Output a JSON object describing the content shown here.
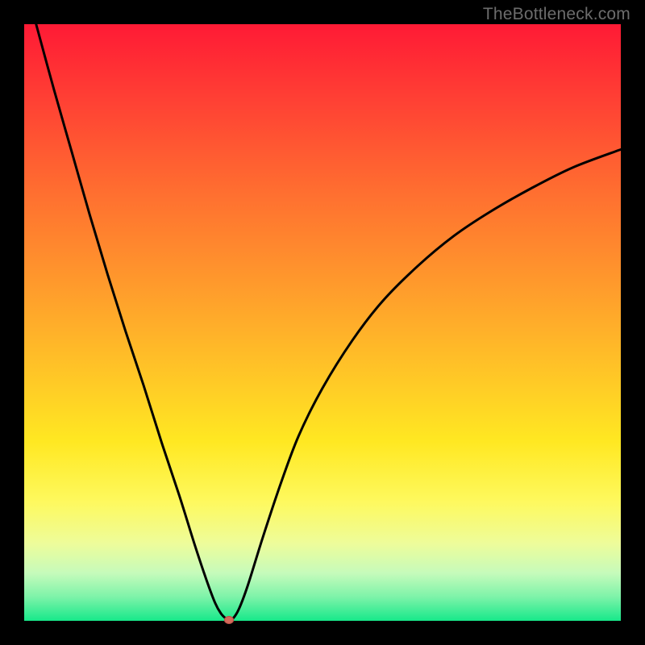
{
  "watermark": "TheBottleneck.com",
  "colors": {
    "frame": "#000000",
    "curve_stroke": "#000000",
    "marker_fill": "#d46a5b",
    "marker_stroke": "#b94f45"
  },
  "chart_data": {
    "type": "line",
    "title": "",
    "xlabel": "",
    "ylabel": "",
    "xlim": [
      0,
      100
    ],
    "ylim": [
      0,
      100
    ],
    "x": [
      2,
      5,
      8,
      11,
      14,
      17,
      20,
      23,
      26,
      28.5,
      30.5,
      32,
      33,
      33.8,
      34.3,
      35,
      36,
      37.5,
      40,
      43,
      46,
      50,
      55,
      60,
      66,
      72,
      78,
      85,
      92,
      100
    ],
    "values": [
      100,
      89,
      78.5,
      68,
      58,
      48.5,
      39.5,
      30,
      21,
      13,
      7,
      3,
      1.2,
      0.4,
      0.2,
      0.4,
      2,
      6,
      14,
      23,
      31,
      39,
      47,
      53.5,
      59.5,
      64.5,
      68.5,
      72.5,
      76,
      79
    ],
    "marker": {
      "x": 34.3,
      "y": 0.2
    },
    "annotations": []
  }
}
